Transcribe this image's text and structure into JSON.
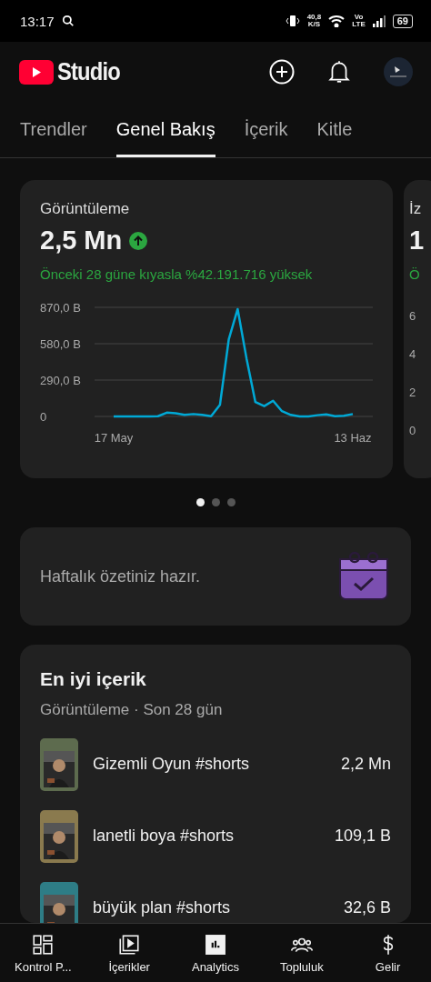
{
  "status_bar": {
    "time": "13:17",
    "speed": "40,8",
    "speed_unit": "K/S",
    "network": "Vo",
    "network_sub": "LTE",
    "battery": "69"
  },
  "app_bar": {
    "title": "Studio"
  },
  "tabs": [
    {
      "label": "Trendler",
      "selected": false
    },
    {
      "label": "Genel Bakış",
      "selected": true
    },
    {
      "label": "İçerik",
      "selected": false
    },
    {
      "label": "Kitle",
      "selected": false
    }
  ],
  "metric_card": {
    "title": "Görüntüleme",
    "value": "2,5 Mn",
    "trend_up": true,
    "comparison": "Önceki 28 güne kıyasla %42.191.716 yüksek",
    "chart_data": {
      "type": "line",
      "categories": [
        "17 May",
        null,
        null,
        null,
        null,
        null,
        null,
        null,
        null,
        null,
        null,
        null,
        null,
        null,
        null,
        null,
        null,
        null,
        null,
        null,
        null,
        null,
        null,
        null,
        null,
        null,
        null,
        "13 Haz"
      ],
      "series": [
        {
          "color": "#00a9d6",
          "values": [
            0,
            0,
            0,
            0,
            0,
            2,
            30,
            26,
            12,
            19,
            12,
            2,
            92,
            616,
            856,
            463,
            115,
            82,
            125,
            42,
            12,
            0,
            0,
            10,
            16,
            2,
            5,
            19
          ]
        }
      ],
      "ylim": [
        0,
        870
      ],
      "yticks": [
        {
          "value": 0,
          "label": "0"
        },
        {
          "value": 290,
          "label": "290,0 B"
        },
        {
          "value": 580,
          "label": "580,0 B"
        },
        {
          "value": 870,
          "label": "870,0 B"
        }
      ]
    }
  },
  "peek_card": {
    "title": "İz",
    "value": "1",
    "comparison": "Ö",
    "ticks": [
      "6",
      "4",
      "2",
      "0"
    ]
  },
  "pager_dots": [
    {
      "selected": true
    },
    {
      "selected": false
    },
    {
      "selected": false
    }
  ],
  "summary_card": {
    "text": "Haftalık özetiniz hazır."
  },
  "top_content": {
    "title": "En iyi içerik",
    "subtitle": "Görüntüleme · Son 28 gün",
    "items": [
      {
        "title": "Gizemli Oyun #shorts",
        "views": "2,2 Mn"
      },
      {
        "title": "lanetli boya #shorts",
        "views": "109,1 B"
      },
      {
        "title": "büyük plan #shorts",
        "views": "32,6 B"
      }
    ]
  },
  "bottom_nav": [
    {
      "label": "Kontrol P...",
      "kind": "dashboard",
      "selected": false
    },
    {
      "label": "İçerikler",
      "kind": "content",
      "selected": false
    },
    {
      "label": "Analytics",
      "kind": "analytics",
      "selected": true
    },
    {
      "label": "Topluluk",
      "kind": "community",
      "selected": false
    },
    {
      "label": "Gelir",
      "kind": "earn",
      "selected": false
    }
  ]
}
